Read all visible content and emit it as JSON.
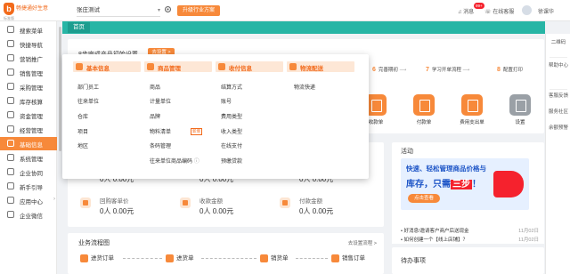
{
  "app": {
    "logo_text": "畅捷通好生意",
    "logo_sub": "标准版"
  },
  "topbar": {
    "store": "张庄测试",
    "plan_button": "升级行业方案",
    "messages": "消息",
    "messages_badge": "99+",
    "service": "在线客服",
    "user": "徐课华"
  },
  "sidebar": {
    "items": [
      {
        "label": "搜索菜单"
      },
      {
        "label": "快捷导航"
      },
      {
        "label": "营销推广"
      },
      {
        "label": "销售管理"
      },
      {
        "label": "采购管理"
      },
      {
        "label": "库存核算"
      },
      {
        "label": "资金管理"
      },
      {
        "label": "经营管理"
      },
      {
        "label": "基础信息"
      },
      {
        "label": "系统管理"
      },
      {
        "label": "企业协同"
      },
      {
        "label": "新手引导"
      },
      {
        "label": "应用中心"
      },
      {
        "label": "企业微信"
      }
    ],
    "active_index": 8
  },
  "tabs": [
    {
      "label": "首页"
    }
  ],
  "setup": {
    "title": "8步完成产品初始设置",
    "button": "去设置 >",
    "steps": [
      {
        "num": "6",
        "label": "完善期初"
      },
      {
        "num": "7",
        "label": "学习开单流程"
      },
      {
        "num": "8",
        "label": "配置打印"
      }
    ],
    "quick": [
      {
        "label": "收款单",
        "icon": "receipt-icon"
      },
      {
        "label": "付款单",
        "icon": "payment-icon"
      },
      {
        "label": "费用支出单",
        "icon": "expense-icon"
      },
      {
        "label": "设置",
        "icon": "settings-icon"
      }
    ]
  },
  "stats": [
    {
      "title": "",
      "value": "0人",
      "amount": "0.00元"
    },
    {
      "title": "",
      "value": "0人",
      "amount": "0.00元"
    },
    {
      "title": "",
      "value": "0人",
      "amount": "0.00元"
    },
    {
      "title": "回购客单价",
      "value": "0人",
      "amount": "0.00元"
    },
    {
      "title": "收款金额",
      "value": "0人",
      "amount": "0.00元"
    },
    {
      "title": "付款金额",
      "value": "0人",
      "amount": "0.00元"
    }
  ],
  "activity": {
    "title": "活动",
    "banner_line1": "快速、轻松管理商品价格与",
    "banner_line2a": "库存，只需",
    "banner_line2b": "三步",
    "banner_line2c": "！",
    "banner_cta": "点击查看",
    "news": [
      {
        "text": "• 好消息!邀请客户商户后送现金",
        "date": "11月02日"
      },
      {
        "text": "• 如何创建一个【线上店铺】？",
        "date": "11月02日"
      }
    ]
  },
  "flow": {
    "title": "业务流程图",
    "link": "去设置流程 >",
    "nodes": [
      "进货订单",
      "进货单",
      "销货单",
      "销售订单"
    ]
  },
  "todo": {
    "title": "待办事项"
  },
  "rail": [
    {
      "label": "二维码"
    },
    {
      "label": "帮助中心"
    },
    {
      "label": "客服反馈"
    },
    {
      "label": "服务社区"
    },
    {
      "label": "余额预警"
    }
  ],
  "dropdown": {
    "columns": [
      {
        "header": "基本信息",
        "items": [
          "部门员工",
          "往来单位",
          "仓库",
          "项目",
          "地区"
        ]
      },
      {
        "header": "商品管理",
        "items": [
          "商品",
          "计量单位",
          "品牌",
          "物料清单",
          "条码管理",
          "往来单位商品编码"
        ],
        "tag": "新增"
      },
      {
        "header": "收付信息",
        "items": [
          "结算方式",
          "账号",
          "费用类型",
          "收入类型",
          "在线支付",
          "预缴贷款"
        ]
      },
      {
        "header": "物流配送",
        "items": [
          "物流快递"
        ]
      }
    ]
  },
  "colors": {
    "accent": "#f7893a",
    "tab_bar": "#27b5a5"
  }
}
